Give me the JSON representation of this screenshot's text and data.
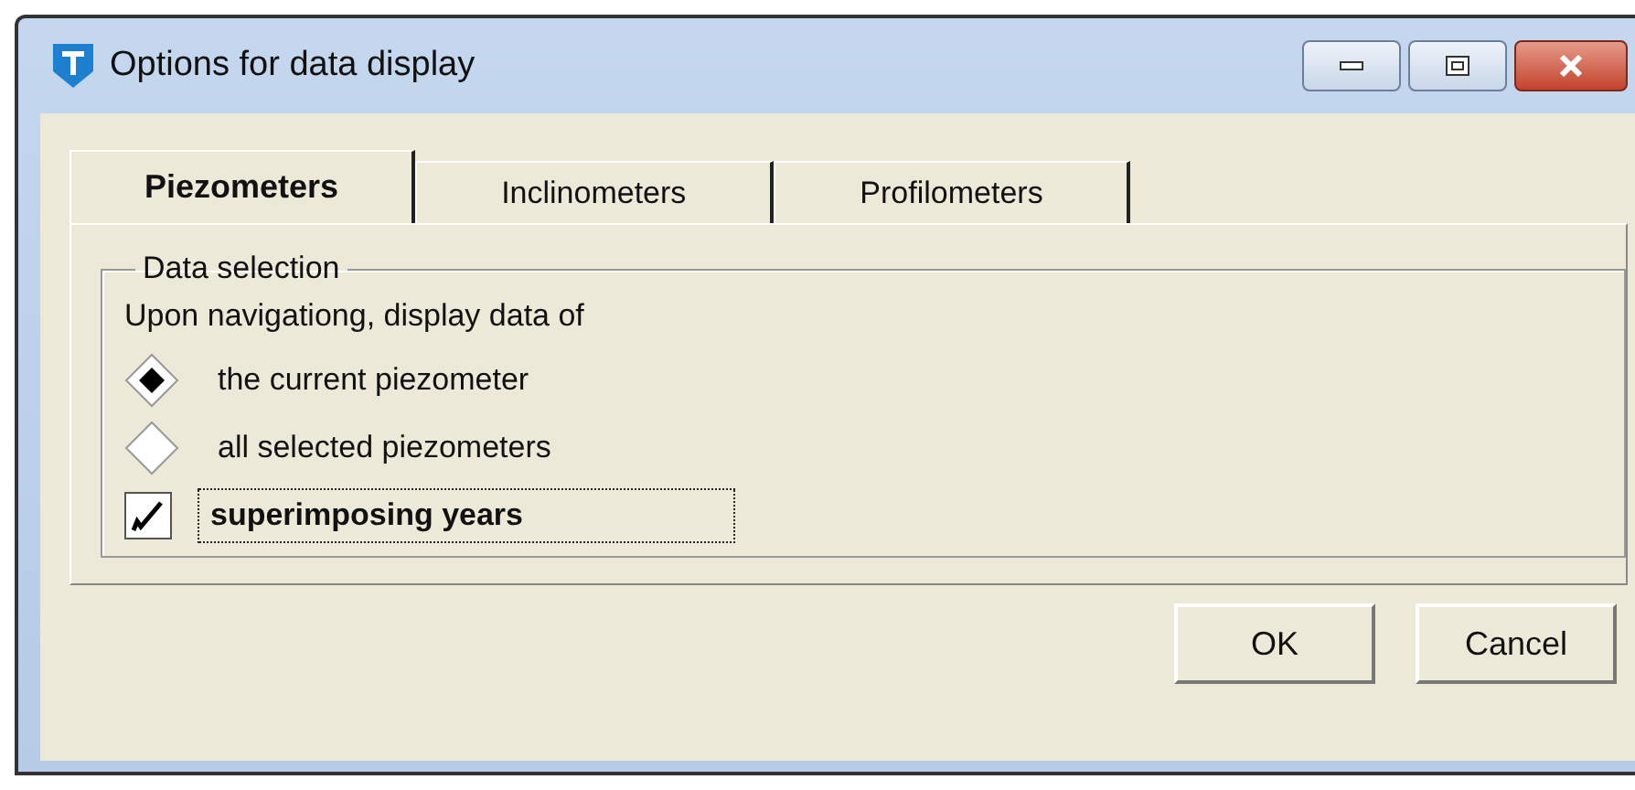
{
  "window": {
    "title": "Options for data display"
  },
  "tabs": [
    {
      "label": "Piezometers",
      "selected": true
    },
    {
      "label": "Inclinometers",
      "selected": false
    },
    {
      "label": "Profilometers",
      "selected": false
    }
  ],
  "group": {
    "title": "Data selection",
    "prompt": "Upon navigationg, display data of",
    "options": [
      {
        "kind": "radio",
        "label": "the current piezometer",
        "selected": true,
        "focused": false
      },
      {
        "kind": "radio",
        "label": "all selected piezometers",
        "selected": false,
        "focused": false
      },
      {
        "kind": "checkbox",
        "label": "superimposing years",
        "checked": true,
        "focused": true
      }
    ]
  },
  "buttons": [
    "OK",
    "Cancel"
  ]
}
